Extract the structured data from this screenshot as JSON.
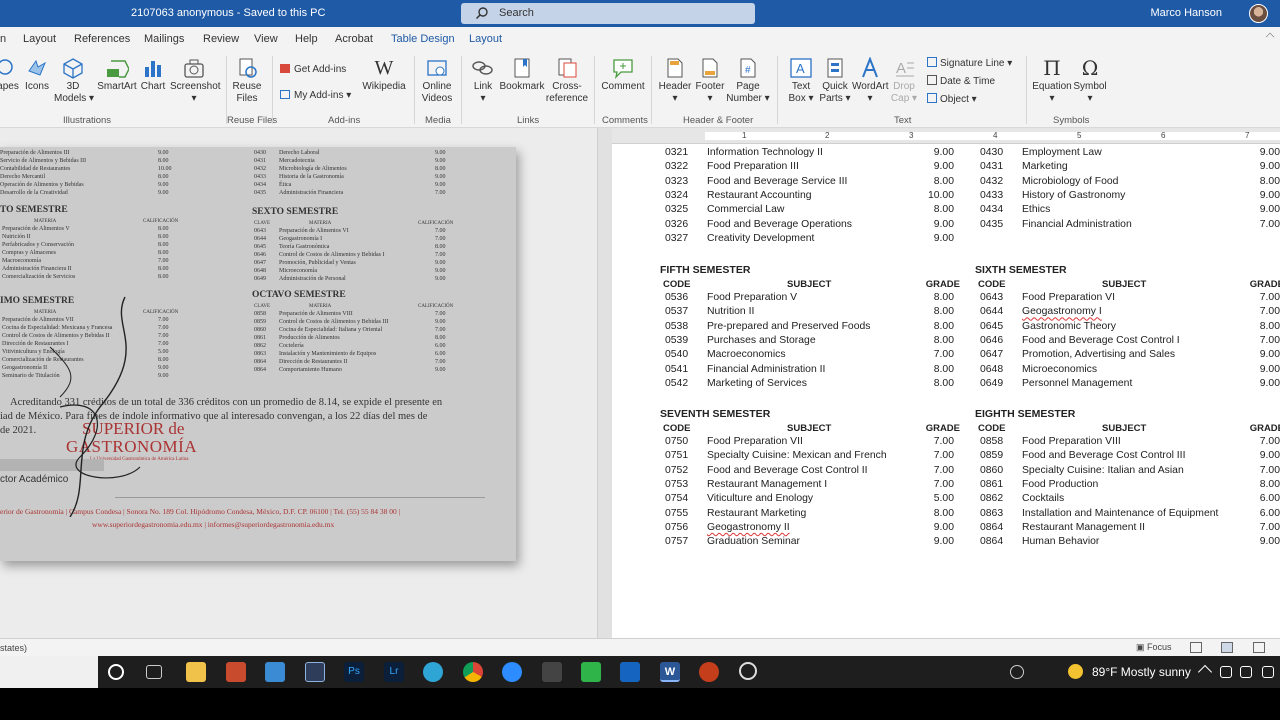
{
  "titlebar": {
    "doc_title": "2107063 anonymous  -  Saved to this PC",
    "search_placeholder": "Search",
    "user_name": "Marco Hanson"
  },
  "tabs": [
    "n",
    "Layout",
    "References",
    "Mailings",
    "Review",
    "View",
    "Help",
    "Acrobat",
    "Table Design",
    "Layout"
  ],
  "ribbon": {
    "buttons": {
      "shapes": "apes",
      "icons": "Icons",
      "models_3d_line1": "3D",
      "models_3d_line2": "Models",
      "smartart": "SmartArt",
      "chart": "Chart",
      "screenshot": "Screenshot",
      "reuse_line1": "Reuse",
      "reuse_line2": "Files",
      "get_addins": "Get Add-ins",
      "my_addins": "My Add-ins",
      "wikipedia": "Wikipedia",
      "online_videos_line1": "Online",
      "online_videos_line2": "Videos",
      "link": "Link",
      "bookmark": "Bookmark",
      "crossref_line1": "Cross-",
      "crossref_line2": "reference",
      "comment": "Comment",
      "header": "Header",
      "footer": "Footer",
      "page_number_line1": "Page",
      "page_number_line2": "Number",
      "text_box_line1": "Text",
      "text_box_line2": "Box",
      "quick_parts_line1": "Quick",
      "quick_parts_line2": "Parts",
      "wordart": "WordArt",
      "drop_cap_line1": "Drop",
      "drop_cap_line2": "Cap",
      "signature_line": "Signature Line",
      "date_time": "Date & Time",
      "object": "Object",
      "equation": "Equation",
      "symbol": "Symbol"
    },
    "groups": {
      "illustrations": "Illustrations",
      "reuse_files": "Reuse Files",
      "addins": "Add-ins",
      "media": "Media",
      "links": "Links",
      "comments": "Comments",
      "header_footer": "Header & Footer",
      "text": "Text",
      "symbols": "Symbols"
    }
  },
  "ruler_numbers": [
    "1",
    "2",
    "3",
    "4",
    "5",
    "6",
    "7"
  ],
  "scan": {
    "top_lines": [
      "Preparación de Alimentos III",
      "Servicio de Alimentos y Bebidas III",
      "Contabilidad de Restaurantes",
      "Derecho Mercantil",
      "Operación de Alimentos y Bebidas",
      "Desarrollo de la Creatividad"
    ],
    "top_grades": [
      "9.00",
      "8.00",
      "10.00",
      "8.00",
      "9.00",
      "9.00"
    ],
    "top_right_codes": [
      "0430",
      "0431",
      "0432",
      "0433",
      "0434",
      "0435"
    ],
    "top_right_lines": [
      "Derecho Laboral",
      "Mercadotecnia",
      "Microbiología de Alimentos",
      "Historia de la Gastronomía",
      "Ética",
      "Administración Financiera"
    ],
    "top_right_grades": [
      "9.00",
      "9.00",
      "8.00",
      "9.00",
      "9.00",
      "7.00"
    ],
    "h_quinto": "TO SEMESTRE",
    "h_sexto": "SEXTO SEMESTRE",
    "h_septimo": "IMO SEMESTRE",
    "h_octavo": "OCTAVO SEMESTRE",
    "col_materia": "MATERIA",
    "col_calif": "CALIFICACIÓN",
    "col_clave": "CLAVE",
    "quinto_lines": [
      "Preparación de Alimentos V",
      "Nutrición II",
      "Perfabricados y Conservación",
      "Compras y Almacenes",
      "Macroeconomía",
      "Administración Financiera II",
      "Comercialización de Servicios"
    ],
    "quinto_grades": [
      "8.00",
      "8.00",
      "8.00",
      "8.00",
      "7.00",
      "8.00",
      "8.00"
    ],
    "sexto_codes": [
      "0643",
      "0644",
      "0645",
      "0646",
      "0647",
      "0648",
      "0649"
    ],
    "sexto_lines": [
      "Preparación de Alimentos VI",
      "Geogastronomía I",
      "Teoría Gastronómica",
      "Control de Costos de Alimentos y Bebidas I",
      "Promoción, Publicidad y Ventas",
      "Microeconomía",
      "Administración de Personal"
    ],
    "sexto_grades": [
      "7.00",
      "7.00",
      "8.00",
      "7.00",
      "9.00",
      "9.00",
      "9.00"
    ],
    "septimo_lines": [
      "Preparación de Alimentos VII",
      "Cocina de Especialidad: Mexicana y Francesa",
      "Control de Costos de Alimentos y Bebidas II",
      "Dirección de Restaurantes I",
      "Vitivinicultura y Enología",
      "Comercialización de Restaurantes",
      "Geogastronomía II",
      "Seminario de Titulación"
    ],
    "septimo_grades": [
      "7.00",
      "7.00",
      "7.00",
      "7.00",
      "5.00",
      "8.00",
      "9.00",
      "9.00"
    ],
    "octavo_codes": [
      "0858",
      "0859",
      "0860",
      "0861",
      "0862",
      "0863",
      "0864",
      "0864"
    ],
    "octavo_lines": [
      "Preparación de Alimentos VIII",
      "Control de Costos de Alimentos y Bebidas III",
      "Cocina de Especialidad: Italiana y Oriental",
      "Producción de Alimentos",
      "Coctelería",
      "Instalación y Mantenimiento de Equipos",
      "Dirección de Restaurantes II",
      "Comportamiento Humano"
    ],
    "octavo_grades": [
      "7.00",
      "9.00",
      "7.00",
      "8.00",
      "6.00",
      "6.00",
      "7.00",
      "9.00"
    ],
    "para1": "Acreditando 331 créditos de un total de 336 créditos con un promedio de 8.14, se expide el presente en",
    "para2": "iad de México. Para fines de índole informativo que al interesado convengan, a los 22 días del mes de",
    "para3": "de 2021.",
    "brand1": "SUPERIOR de",
    "brand2": "GASTRONOMÍA",
    "brand_tag": "La Universidad Gastronómica de América Latina",
    "signer": "ctor Académico",
    "footer1": "erior de Gastronomía | Campus Condesa | Sonora No. 189 Col. Hipódromo Condesa, México, D.F. CP. 06100 | Tel. (55) 55 84 38 00 |",
    "footer2": "www.superiordegastronomia.edu.mx | informes@superiordegastronomia.edu.mx"
  },
  "doc": {
    "top_left": [
      {
        "code": "0321",
        "subject": "Information Technology II",
        "grade": "9.00"
      },
      {
        "code": "0322",
        "subject": "Food Preparation III",
        "grade": "9.00"
      },
      {
        "code": "0323",
        "subject": "Food and Beverage Service III",
        "grade": "8.00"
      },
      {
        "code": "0324",
        "subject": "Restaurant Accounting",
        "grade": "10.00"
      },
      {
        "code": "0325",
        "subject": "Commercial Law",
        "grade": "8.00"
      },
      {
        "code": "0326",
        "subject": "Food and Beverage Operations",
        "grade": "9.00"
      },
      {
        "code": "0327",
        "subject": "Creativity Development",
        "grade": "9.00"
      }
    ],
    "top_right": [
      {
        "code": "0430",
        "subject": "Employment Law",
        "grade": "9.00"
      },
      {
        "code": "0431",
        "subject": "Marketing",
        "grade": "9.00"
      },
      {
        "code": "0432",
        "subject": "Microbiology of Food",
        "grade": "8.00"
      },
      {
        "code": "0433",
        "subject": "History of Gastronomy",
        "grade": "9.00"
      },
      {
        "code": "0434",
        "subject": "Ethics",
        "grade": "9.00"
      },
      {
        "code": "0435",
        "subject": "Financial Administration",
        "grade": "7.00"
      }
    ],
    "headers": {
      "code": "CODE",
      "subject": "SUBJECT",
      "grade": "GRADE"
    },
    "fifth": {
      "title": "FIFTH SEMESTER",
      "rows": [
        {
          "code": "0536",
          "subject": "Food Preparation V",
          "grade": "8.00"
        },
        {
          "code": "0537",
          "subject": "Nutrition II",
          "grade": "8.00"
        },
        {
          "code": "0538",
          "subject": "Pre-prepared and Preserved Foods",
          "grade": "8.00"
        },
        {
          "code": "0539",
          "subject": "Purchases and Storage",
          "grade": "8.00"
        },
        {
          "code": "0540",
          "subject": "Macroeconomics",
          "grade": "7.00"
        },
        {
          "code": "0541",
          "subject": "Financial Administration II",
          "grade": "8.00"
        },
        {
          "code": "0542",
          "subject": "Marketing of Services",
          "grade": "8.00"
        }
      ]
    },
    "sixth": {
      "title": "SIXTH SEMESTER",
      "rows": [
        {
          "code": "0643",
          "subject": "Food Preparation VI",
          "grade": "7.00"
        },
        {
          "code": "0644",
          "subject": "Geogastronomy I",
          "grade": "7.00"
        },
        {
          "code": "0645",
          "subject": "Gastronomic Theory",
          "grade": "8.00"
        },
        {
          "code": "0646",
          "subject": "Food and Beverage Cost Control I",
          "grade": "7.00"
        },
        {
          "code": "0647",
          "subject": "Promotion, Advertising and Sales",
          "grade": "9.00"
        },
        {
          "code": "0648",
          "subject": "Microeconomics",
          "grade": "9.00"
        },
        {
          "code": "0649",
          "subject": "Personnel Management",
          "grade": "9.00"
        }
      ]
    },
    "seventh": {
      "title": "SEVENTH SEMESTER",
      "rows": [
        {
          "code": "0750",
          "subject": "Food Preparation VII",
          "grade": "7.00"
        },
        {
          "code": "0751",
          "subject": "Specialty Cuisine: Mexican and French",
          "grade": "7.00"
        },
        {
          "code": "0752",
          "subject": "Food and Beverage Cost Control II",
          "grade": "7.00"
        },
        {
          "code": "0753",
          "subject": "Restaurant Management I",
          "grade": "7.00"
        },
        {
          "code": "0754",
          "subject": "Viticulture and Enology",
          "grade": "5.00"
        },
        {
          "code": "0755",
          "subject": "Restaurant Marketing",
          "grade": "8.00"
        },
        {
          "code": "0756",
          "subject": "Geogastronomy II",
          "grade": "9.00"
        },
        {
          "code": "0757",
          "subject": "Graduation Seminar",
          "grade": "9.00"
        }
      ]
    },
    "eighth": {
      "title": "EIGHTH SEMESTER",
      "rows": [
        {
          "code": "0858",
          "subject": "Food Preparation VIII",
          "grade": "7.00"
        },
        {
          "code": "0859",
          "subject": "Food and Beverage Cost Control III",
          "grade": "9.00"
        },
        {
          "code": "0860",
          "subject": "Specialty Cuisine: Italian and Asian",
          "grade": "7.00"
        },
        {
          "code": "0861",
          "subject": "Food Production",
          "grade": "8.00"
        },
        {
          "code": "0862",
          "subject": "Cocktails",
          "grade": "6.00"
        },
        {
          "code": "0863",
          "subject": "Installation and Maintenance of Equipment",
          "grade": "6.00"
        },
        {
          "code": "0864",
          "subject": "Restaurant Management II",
          "grade": "7.00"
        },
        {
          "code": "0864",
          "subject": "Human Behavior",
          "grade": "9.00"
        }
      ]
    }
  },
  "status": {
    "left": "states)",
    "focus": "Focus"
  },
  "taskbar": {
    "weather": "89°F  Mostly sunny"
  }
}
